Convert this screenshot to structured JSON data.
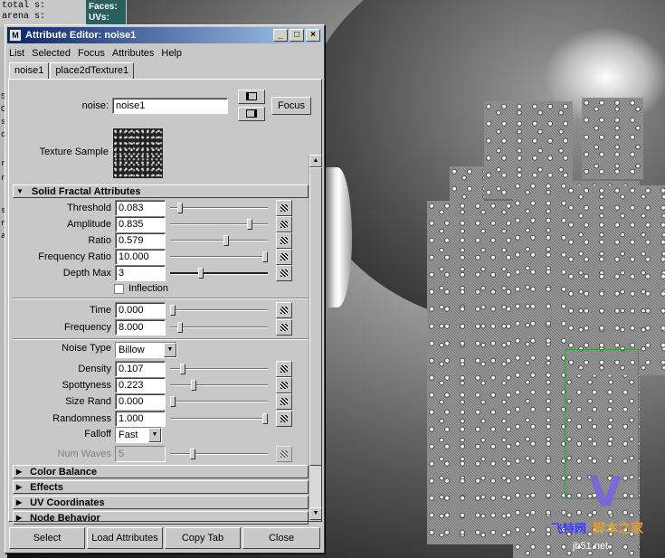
{
  "background": {
    "top_strip_lines": [
      "total s:",
      "arena s:"
    ],
    "hud_labels": [
      "Faces:",
      "UVs:"
    ],
    "left_strip_chars": [
      "S",
      "C",
      "s",
      "c",
      "r",
      "r",
      "s",
      "r",
      "a"
    ]
  },
  "window": {
    "title": "Attribute Editor: noise1",
    "min_glyph": "_",
    "max_glyph": "□",
    "close_glyph": "×"
  },
  "menu": [
    "List",
    "Selected",
    "Focus",
    "Attributes",
    "Help"
  ],
  "tabs": [
    "noise1",
    "place2dTexture1"
  ],
  "header": {
    "node_label": "noise:",
    "node_value": "noise1",
    "focus_label": "Focus",
    "texture_sample_label": "Texture Sample"
  },
  "sections": {
    "solid_fractal": "Solid Fractal Attributes",
    "color_balance": "Color Balance",
    "effects": "Effects",
    "uv_coordinates": "UV Coordinates",
    "node_behavior": "Node Behavior"
  },
  "attributes": {
    "threshold": {
      "label": "Threshold",
      "value": "0.083",
      "slider": 0.083
    },
    "amplitude": {
      "label": "Amplitude",
      "value": "0.835",
      "slider": 0.835
    },
    "ratio": {
      "label": "Ratio",
      "value": "0.579",
      "slider": 0.579
    },
    "frequency_ratio": {
      "label": "Frequency Ratio",
      "value": "10.000",
      "slider": 1.0
    },
    "depth_max": {
      "label": "Depth Max",
      "value": "3",
      "slider": 0.3
    },
    "inflection": {
      "label": "Inflection",
      "checked": false
    },
    "time": {
      "label": "Time",
      "value": "0.000",
      "slider": 0.0
    },
    "frequency": {
      "label": "Frequency",
      "value": "8.000",
      "slider": 0.08
    },
    "noise_type": {
      "label": "Noise Type",
      "value": "Billow"
    },
    "density": {
      "label": "Density",
      "value": "0.107",
      "slider": 0.107
    },
    "spottyness": {
      "label": "Spottyness",
      "value": "0.223",
      "slider": 0.223
    },
    "size_rand": {
      "label": "Size Rand",
      "value": "0.000",
      "slider": 0.0
    },
    "randomness": {
      "label": "Randomness",
      "value": "1.000",
      "slider": 1.0
    },
    "falloff": {
      "label": "Falloff",
      "value": "Fast"
    },
    "num_waves": {
      "label": "Num Waves",
      "value": "5",
      "slider": 0.22
    }
  },
  "buttons": {
    "select": "Select",
    "load_attributes": "Load Attributes",
    "copy_tab": "Copy Tab",
    "close": "Close"
  },
  "watermark": {
    "logo_letter": "V",
    "text_main": "脚本之家",
    "text_brand": "飞特网",
    "url": "jb51.net"
  }
}
